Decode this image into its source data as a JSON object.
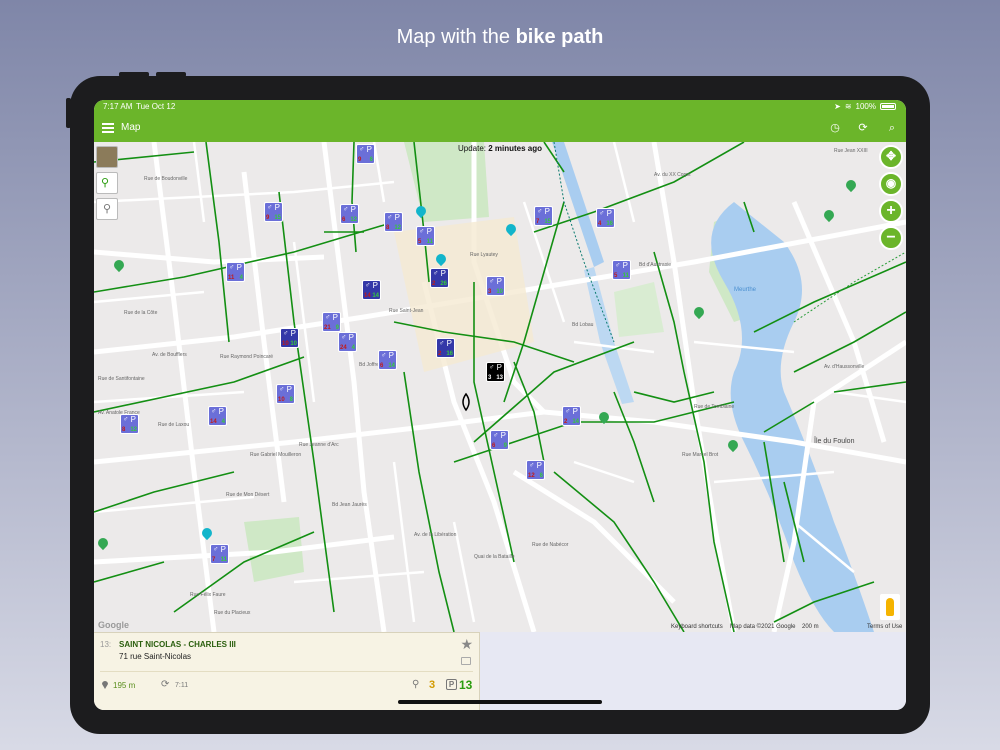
{
  "headline": {
    "prefix": "Map with the ",
    "bold": "bike path"
  },
  "status_bar": {
    "time": "7:17 AM",
    "date": "Tue Oct 12",
    "battery": "100%"
  },
  "app_bar": {
    "title": "Map",
    "accent": "#6bb52a"
  },
  "map": {
    "update_prefix": "Update: ",
    "update_value": "2 minutes ago",
    "attribution_logo": "Google",
    "footer": {
      "shortcuts": "Keyboard shortcuts",
      "data": "Map data ©2021 Google",
      "scale": "200 m",
      "terms": "Terms of Use"
    },
    "labels": [
      {
        "text": "Rue de Boudonville",
        "cls": ""
      },
      {
        "text": "Rue de la Côte",
        "cls": ""
      },
      {
        "text": "Av. de Boufflers",
        "cls": ""
      },
      {
        "text": "Rue de Santifontaine",
        "cls": ""
      },
      {
        "text": "Av. Anatole France",
        "cls": ""
      },
      {
        "text": "Rue de Laxou",
        "cls": ""
      },
      {
        "text": "Rue Raymond Poincaré",
        "cls": ""
      },
      {
        "text": "Rue Gabriel Mouilleron",
        "cls": ""
      },
      {
        "text": "Rue de Mon Désert",
        "cls": ""
      },
      {
        "text": "Rue Jeanne d'Arc",
        "cls": ""
      },
      {
        "text": "Rue Félix Faure",
        "cls": ""
      },
      {
        "text": "Rue du Placieux",
        "cls": ""
      },
      {
        "text": "Bd Joffre",
        "cls": ""
      },
      {
        "text": "Rue Lyautey",
        "cls": ""
      },
      {
        "text": "Bd Lobau",
        "cls": ""
      },
      {
        "text": "Bd d'Austrasie",
        "cls": ""
      },
      {
        "text": "Rue de Tomblaine",
        "cls": ""
      },
      {
        "text": "Av. du XX Corps",
        "cls": ""
      },
      {
        "text": "Rue Jean XXIII",
        "cls": ""
      },
      {
        "text": "Av. d'Haussonville",
        "cls": ""
      },
      {
        "text": "Quai de la Bataille",
        "cls": ""
      },
      {
        "text": "Rue de Nabécor",
        "cls": ""
      },
      {
        "text": "Bd Jean Jaurès",
        "cls": ""
      },
      {
        "text": "Rue Marcel Brot",
        "cls": ""
      },
      {
        "text": "Av. de la Libération",
        "cls": ""
      },
      {
        "text": "Meurthe",
        "cls": "water"
      },
      {
        "text": "Île du Foulon",
        "cls": "big"
      },
      {
        "text": "Rue Saint-Jean",
        "cls": ""
      }
    ],
    "stations": [
      {
        "bikes": "9",
        "free": "6",
        "style": ""
      },
      {
        "bikes": "9",
        "free": "15",
        "style": ""
      },
      {
        "bikes": "6",
        "free": "12",
        "style": ""
      },
      {
        "bikes": "8",
        "free": "12",
        "style": ""
      },
      {
        "bikes": "5",
        "free": "11",
        "style": ""
      },
      {
        "bikes": "7",
        "free": "15",
        "style": ""
      },
      {
        "bikes": "4",
        "free": "16",
        "style": ""
      },
      {
        "bikes": "11",
        "free": "4",
        "style": ""
      },
      {
        "bikes": "14",
        "free": "14",
        "style": "dark"
      },
      {
        "bikes": "2",
        "free": "26",
        "style": "dark"
      },
      {
        "bikes": "3",
        "free": "10",
        "style": ""
      },
      {
        "bikes": "5",
        "free": "11",
        "style": ""
      },
      {
        "bikes": "21",
        "free": "9",
        "style": ""
      },
      {
        "bikes": "10",
        "free": "10",
        "style": "dark"
      },
      {
        "bikes": "24",
        "free": "4",
        "style": ""
      },
      {
        "bikes": "6",
        "free": "14",
        "style": ""
      },
      {
        "bikes": "2",
        "free": "16",
        "style": "dark"
      },
      {
        "bikes": "3",
        "free": "13",
        "style": "black"
      },
      {
        "bikes": "10",
        "free": "8",
        "style": ""
      },
      {
        "bikes": "14",
        "free": "4",
        "style": ""
      },
      {
        "bikes": "8",
        "free": "12",
        "style": ""
      },
      {
        "bikes": "2",
        "free": "14",
        "style": ""
      },
      {
        "bikes": "6",
        "free": "9",
        "style": ""
      },
      {
        "bikes": "12",
        "free": "6",
        "style": ""
      },
      {
        "bikes": "7",
        "free": "11",
        "style": ""
      }
    ],
    "controls": [
      "move-icon",
      "locate-icon",
      "zoom-in-icon",
      "zoom-out-icon"
    ]
  },
  "selected_station": {
    "number": "13:",
    "name": "SAINT NICOLAS - CHARLES III",
    "address": "71 rue Saint-Nicolas",
    "distance": "195 m",
    "updated": "7:11",
    "bikes": "3",
    "docks": "13"
  }
}
